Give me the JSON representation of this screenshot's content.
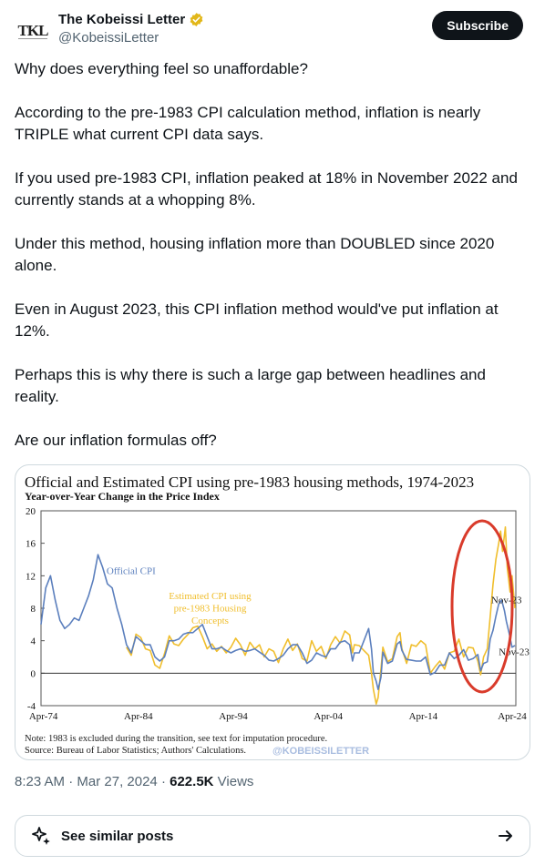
{
  "author": {
    "avatar_text": "TKL",
    "name": "The Kobeissi Letter",
    "handle": "@KobeissiLetter"
  },
  "header": {
    "subscribe_label": "Subscribe"
  },
  "tweet": {
    "paragraphs": [
      "Why does everything feel so unaffordable?",
      "According to the pre-1983 CPI calculation method, inflation is nearly TRIPLE what current CPI data says.",
      "If you used pre-1983 CPI, inflation peaked at 18% in November 2022 and currently stands at a whopping 8%.",
      "Under this method, housing inflation more than DOUBLED since 2020 alone.",
      "Even in August 2023, this CPI inflation method would've put inflation at 12%.",
      "Perhaps this is why there is such a large gap between headlines and reality.",
      "Are our inflation formulas off?"
    ]
  },
  "chart_data": {
    "type": "line",
    "title": "Official and Estimated CPI using pre-1983 housing methods, 1974-2023",
    "subtitle": "Year-over-Year Change in the Price Index",
    "ylim": [
      -4,
      20
    ],
    "xlim": [
      1974,
      2024
    ],
    "y_ticks": [
      "20",
      "16",
      "12",
      "8",
      "4",
      "0",
      "-4"
    ],
    "x_ticks": [
      {
        "label": "Apr-74",
        "x": 1974.25
      },
      {
        "label": "Apr-84",
        "x": 1984.25
      },
      {
        "label": "Apr-94",
        "x": 1994.25
      },
      {
        "label": "Apr-04",
        "x": 2004.25
      },
      {
        "label": "Apr-14",
        "x": 2014.25
      },
      {
        "label": "Apr-24",
        "x": 2024.25
      }
    ],
    "grid": false,
    "series": [
      {
        "name": "Official CPI",
        "color": "#5b7fbd",
        "points": [
          [
            1974,
            6
          ],
          [
            1974.5,
            10.5
          ],
          [
            1975,
            12
          ],
          [
            1975.5,
            9
          ],
          [
            1976,
            6.5
          ],
          [
            1976.5,
            5.5
          ],
          [
            1977,
            6
          ],
          [
            1977.5,
            6.8
          ],
          [
            1978,
            6.5
          ],
          [
            1978.5,
            8
          ],
          [
            1979,
            9.5
          ],
          [
            1979.5,
            11.5
          ],
          [
            1980,
            14.6
          ],
          [
            1980.5,
            13
          ],
          [
            1981,
            11
          ],
          [
            1981.5,
            10.5
          ],
          [
            1982,
            8
          ],
          [
            1982.5,
            6
          ],
          [
            1983,
            3.5
          ],
          [
            1983.5,
            2.5
          ],
          [
            1984,
            4.5
          ],
          [
            1984.5,
            4
          ],
          [
            1985,
            3.5
          ],
          [
            1985.5,
            3.5
          ],
          [
            1986,
            2
          ],
          [
            1986.5,
            1.5
          ],
          [
            1987,
            2
          ],
          [
            1987.5,
            4
          ],
          [
            1988,
            4
          ],
          [
            1988.5,
            4.2
          ],
          [
            1989,
            4.8
          ],
          [
            1989.5,
            5
          ],
          [
            1990,
            5
          ],
          [
            1990.5,
            5.5
          ],
          [
            1991,
            6
          ],
          [
            1991.5,
            4.5
          ],
          [
            1992,
            3
          ],
          [
            1992.5,
            3
          ],
          [
            1993,
            3.2
          ],
          [
            1993.5,
            2.8
          ],
          [
            1994,
            2.5
          ],
          [
            1994.5,
            2.8
          ],
          [
            1995,
            3
          ],
          [
            1995.5,
            2.7
          ],
          [
            1996,
            2.8
          ],
          [
            1996.5,
            3
          ],
          [
            1997,
            2.6
          ],
          [
            1997.5,
            2.2
          ],
          [
            1998,
            1.6
          ],
          [
            1998.5,
            1.5
          ],
          [
            1999,
            1.8
          ],
          [
            1999.5,
            2.2
          ],
          [
            2000,
            3
          ],
          [
            2000.5,
            3.5
          ],
          [
            2001,
            3.5
          ],
          [
            2001.5,
            2.5
          ],
          [
            2002,
            1.2
          ],
          [
            2002.5,
            1.6
          ],
          [
            2003,
            2.5
          ],
          [
            2003.5,
            2.2
          ],
          [
            2004,
            2
          ],
          [
            2004.5,
            3
          ],
          [
            2005,
            3
          ],
          [
            2005.5,
            3.8
          ],
          [
            2006,
            4
          ],
          [
            2006.5,
            3.5
          ],
          [
            2006.8,
            1.5
          ],
          [
            2007,
            2.5
          ],
          [
            2007.5,
            2.5
          ],
          [
            2008,
            4
          ],
          [
            2008.5,
            5.5
          ],
          [
            2008.8,
            3
          ],
          [
            2009,
            0
          ],
          [
            2009.3,
            -1
          ],
          [
            2009.5,
            -2
          ],
          [
            2009.8,
            -0.5
          ],
          [
            2010,
            2.6
          ],
          [
            2010.5,
            1.2
          ],
          [
            2011,
            1.5
          ],
          [
            2011.5,
            3.6
          ],
          [
            2011.8,
            3.9
          ],
          [
            2012,
            2.8
          ],
          [
            2012.5,
            1.7
          ],
          [
            2013,
            1.6
          ],
          [
            2013.5,
            1.5
          ],
          [
            2014,
            1.5
          ],
          [
            2014.5,
            2
          ],
          [
            2015,
            -0.2
          ],
          [
            2015.5,
            0.1
          ],
          [
            2016,
            1
          ],
          [
            2016.5,
            1
          ],
          [
            2017,
            2.5
          ],
          [
            2017.5,
            1.8
          ],
          [
            2018,
            2.2
          ],
          [
            2018.5,
            2.9
          ],
          [
            2019,
            1.6
          ],
          [
            2019.5,
            1.8
          ],
          [
            2020,
            2.3
          ],
          [
            2020.3,
            0.3
          ],
          [
            2020.6,
            1.2
          ],
          [
            2021,
            1.4
          ],
          [
            2021.3,
            4.2
          ],
          [
            2021.6,
            5.3
          ],
          [
            2021.9,
            7
          ],
          [
            2022.2,
            8.5
          ],
          [
            2022.5,
            9
          ],
          [
            2022.8,
            7.7
          ],
          [
            2023,
            6.4
          ],
          [
            2023.3,
            4.9
          ],
          [
            2023.6,
            3.2
          ],
          [
            2023.9,
            3.4
          ]
        ]
      },
      {
        "name": "Estimated CPI using pre-1983 Housing Concepts",
        "color": "#f0be2c",
        "points": [
          [
            1983,
            3.2
          ],
          [
            1983.5,
            2.2
          ],
          [
            1984,
            4.8
          ],
          [
            1984.5,
            4.4
          ],
          [
            1985,
            3
          ],
          [
            1985.5,
            2.8
          ],
          [
            1986,
            1
          ],
          [
            1986.5,
            0.6
          ],
          [
            1987,
            2.4
          ],
          [
            1987.5,
            4.6
          ],
          [
            1988,
            3.6
          ],
          [
            1988.5,
            3.4
          ],
          [
            1989,
            4.2
          ],
          [
            1989.5,
            4.8
          ],
          [
            1990,
            5.6
          ],
          [
            1990.5,
            5.8
          ],
          [
            1991,
            4.5
          ],
          [
            1991.5,
            3
          ],
          [
            1992,
            3.6
          ],
          [
            1992.5,
            2.7
          ],
          [
            1993,
            3.3
          ],
          [
            1993.5,
            2.5
          ],
          [
            1994,
            3.2
          ],
          [
            1994.5,
            4.3
          ],
          [
            1995,
            3.5
          ],
          [
            1995.5,
            2.2
          ],
          [
            1996,
            3.8
          ],
          [
            1996.5,
            3
          ],
          [
            1997,
            3.5
          ],
          [
            1997.5,
            2
          ],
          [
            1998,
            3
          ],
          [
            1998.5,
            2.7
          ],
          [
            1999,
            1.3
          ],
          [
            1999.5,
            3
          ],
          [
            2000,
            4.2
          ],
          [
            2000.5,
            2.8
          ],
          [
            2001,
            3.6
          ],
          [
            2001.5,
            1.8
          ],
          [
            2002,
            1.5
          ],
          [
            2002.5,
            4
          ],
          [
            2003,
            2.7
          ],
          [
            2003.5,
            3.3
          ],
          [
            2004,
            1.8
          ],
          [
            2004.5,
            3.5
          ],
          [
            2005,
            4.5
          ],
          [
            2005.5,
            3.7
          ],
          [
            2006,
            5.2
          ],
          [
            2006.5,
            4.7
          ],
          [
            2006.8,
            2.5
          ],
          [
            2007,
            3.5
          ],
          [
            2007.5,
            3.4
          ],
          [
            2008,
            2.8
          ],
          [
            2008.5,
            2.2
          ],
          [
            2008.8,
            0
          ],
          [
            2009,
            -2
          ],
          [
            2009.3,
            -3.8
          ],
          [
            2009.5,
            -3
          ],
          [
            2009.8,
            0.5
          ],
          [
            2010,
            3.2
          ],
          [
            2010.5,
            1.4
          ],
          [
            2011,
            1.8
          ],
          [
            2011.5,
            4.5
          ],
          [
            2011.8,
            5
          ],
          [
            2012,
            3
          ],
          [
            2012.5,
            1.2
          ],
          [
            2013,
            3.5
          ],
          [
            2013.5,
            3.3
          ],
          [
            2014,
            4
          ],
          [
            2014.5,
            3.5
          ],
          [
            2015,
            0
          ],
          [
            2015.5,
            0.8
          ],
          [
            2016,
            1.5
          ],
          [
            2016.5,
            0.5
          ],
          [
            2017,
            2.5
          ],
          [
            2017.5,
            2.7
          ],
          [
            2018,
            4.2
          ],
          [
            2018.5,
            2
          ],
          [
            2019,
            3.2
          ],
          [
            2019.5,
            3.1
          ],
          [
            2020,
            1.5
          ],
          [
            2020.3,
            -0.2
          ],
          [
            2020.6,
            2
          ],
          [
            2021,
            3
          ],
          [
            2021.3,
            7
          ],
          [
            2021.6,
            11
          ],
          [
            2021.9,
            14
          ],
          [
            2022.2,
            16
          ],
          [
            2022.4,
            17.5
          ],
          [
            2022.6,
            15
          ],
          [
            2022.9,
            18
          ],
          [
            2023.1,
            13
          ],
          [
            2023.4,
            10
          ],
          [
            2023.6,
            12
          ],
          [
            2023.9,
            8
          ]
        ]
      }
    ],
    "annotations": [
      {
        "text": "Official CPI",
        "x": 1980.9,
        "y": 12.2,
        "color": "#5b7fbd"
      },
      {
        "text": "Estimated CPI using",
        "x": 1991.8,
        "y": 9.1,
        "color": "#f0be2c"
      },
      {
        "text": "pre-1983 Housing",
        "x": 1991.8,
        "y": 7.6,
        "color": "#f0be2c"
      },
      {
        "text": "Concepts",
        "x": 1991.8,
        "y": 6.1,
        "color": "#f0be2c"
      },
      {
        "text": "Nov-23",
        "x": 2021.4,
        "y": 8.6,
        "color": "#222222"
      },
      {
        "text": "Nov-23",
        "x": 2022.2,
        "y": 2.2,
        "color": "#222222"
      }
    ],
    "note": "Note: 1983 is excluded during the transition, see text for imputation procedure.",
    "source": "Source: Bureau of Labor Statistics; Authors' Calculations.",
    "watermark": "@KOBEISSILETTER",
    "highlight_color": "#d93b2b"
  },
  "meta": {
    "time": "8:23 AM",
    "date": "Mar 27, 2024",
    "views_count": "622.5K",
    "views_label": "Views"
  },
  "similar": {
    "label": "See similar posts"
  }
}
